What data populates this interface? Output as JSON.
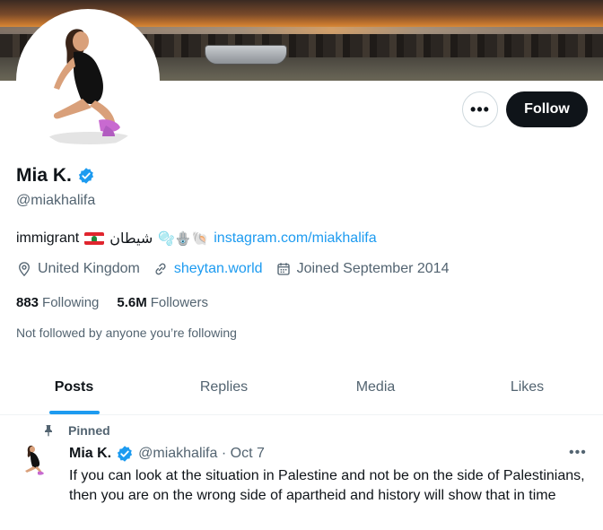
{
  "profile": {
    "display_name": "Mia K.",
    "handle": "@miakhalifa",
    "bio_text": "immigrant",
    "bio_arabic": "شيطان",
    "bio_emojis": "🫧🪬🐚",
    "bio_link": "instagram.com/miakhalifa",
    "location": "United Kingdom",
    "website": "sheytan.world",
    "joined": "Joined September 2014",
    "following_count": "883",
    "following_label": "Following",
    "followers_count": "5.6M",
    "followers_label": "Followers",
    "followed_by": "Not followed by anyone you’re following"
  },
  "actions": {
    "more_label": "•••",
    "follow_label": "Follow"
  },
  "tabs": [
    {
      "label": "Posts",
      "active": true
    },
    {
      "label": "Replies",
      "active": false
    },
    {
      "label": "Media",
      "active": false
    },
    {
      "label": "Likes",
      "active": false
    }
  ],
  "pinned_tweet": {
    "pinned_label": "Pinned",
    "name": "Mia K.",
    "handle_date": "@miakhalifa · Oct 7",
    "more_label": "•••",
    "text": "If you can look at the situation in Palestine and not be on the side of Palestinians, then you are on the wrong side of apartheid and history will show that in time"
  },
  "colors": {
    "accent": "#1d9bf0",
    "text_primary": "#0f1419",
    "text_secondary": "#536471",
    "follow_bg": "#0f1419"
  },
  "icons": [
    "location-icon",
    "link-icon",
    "calendar-icon",
    "verified-badge-icon",
    "pin-icon",
    "lebanon-flag-icon"
  ]
}
